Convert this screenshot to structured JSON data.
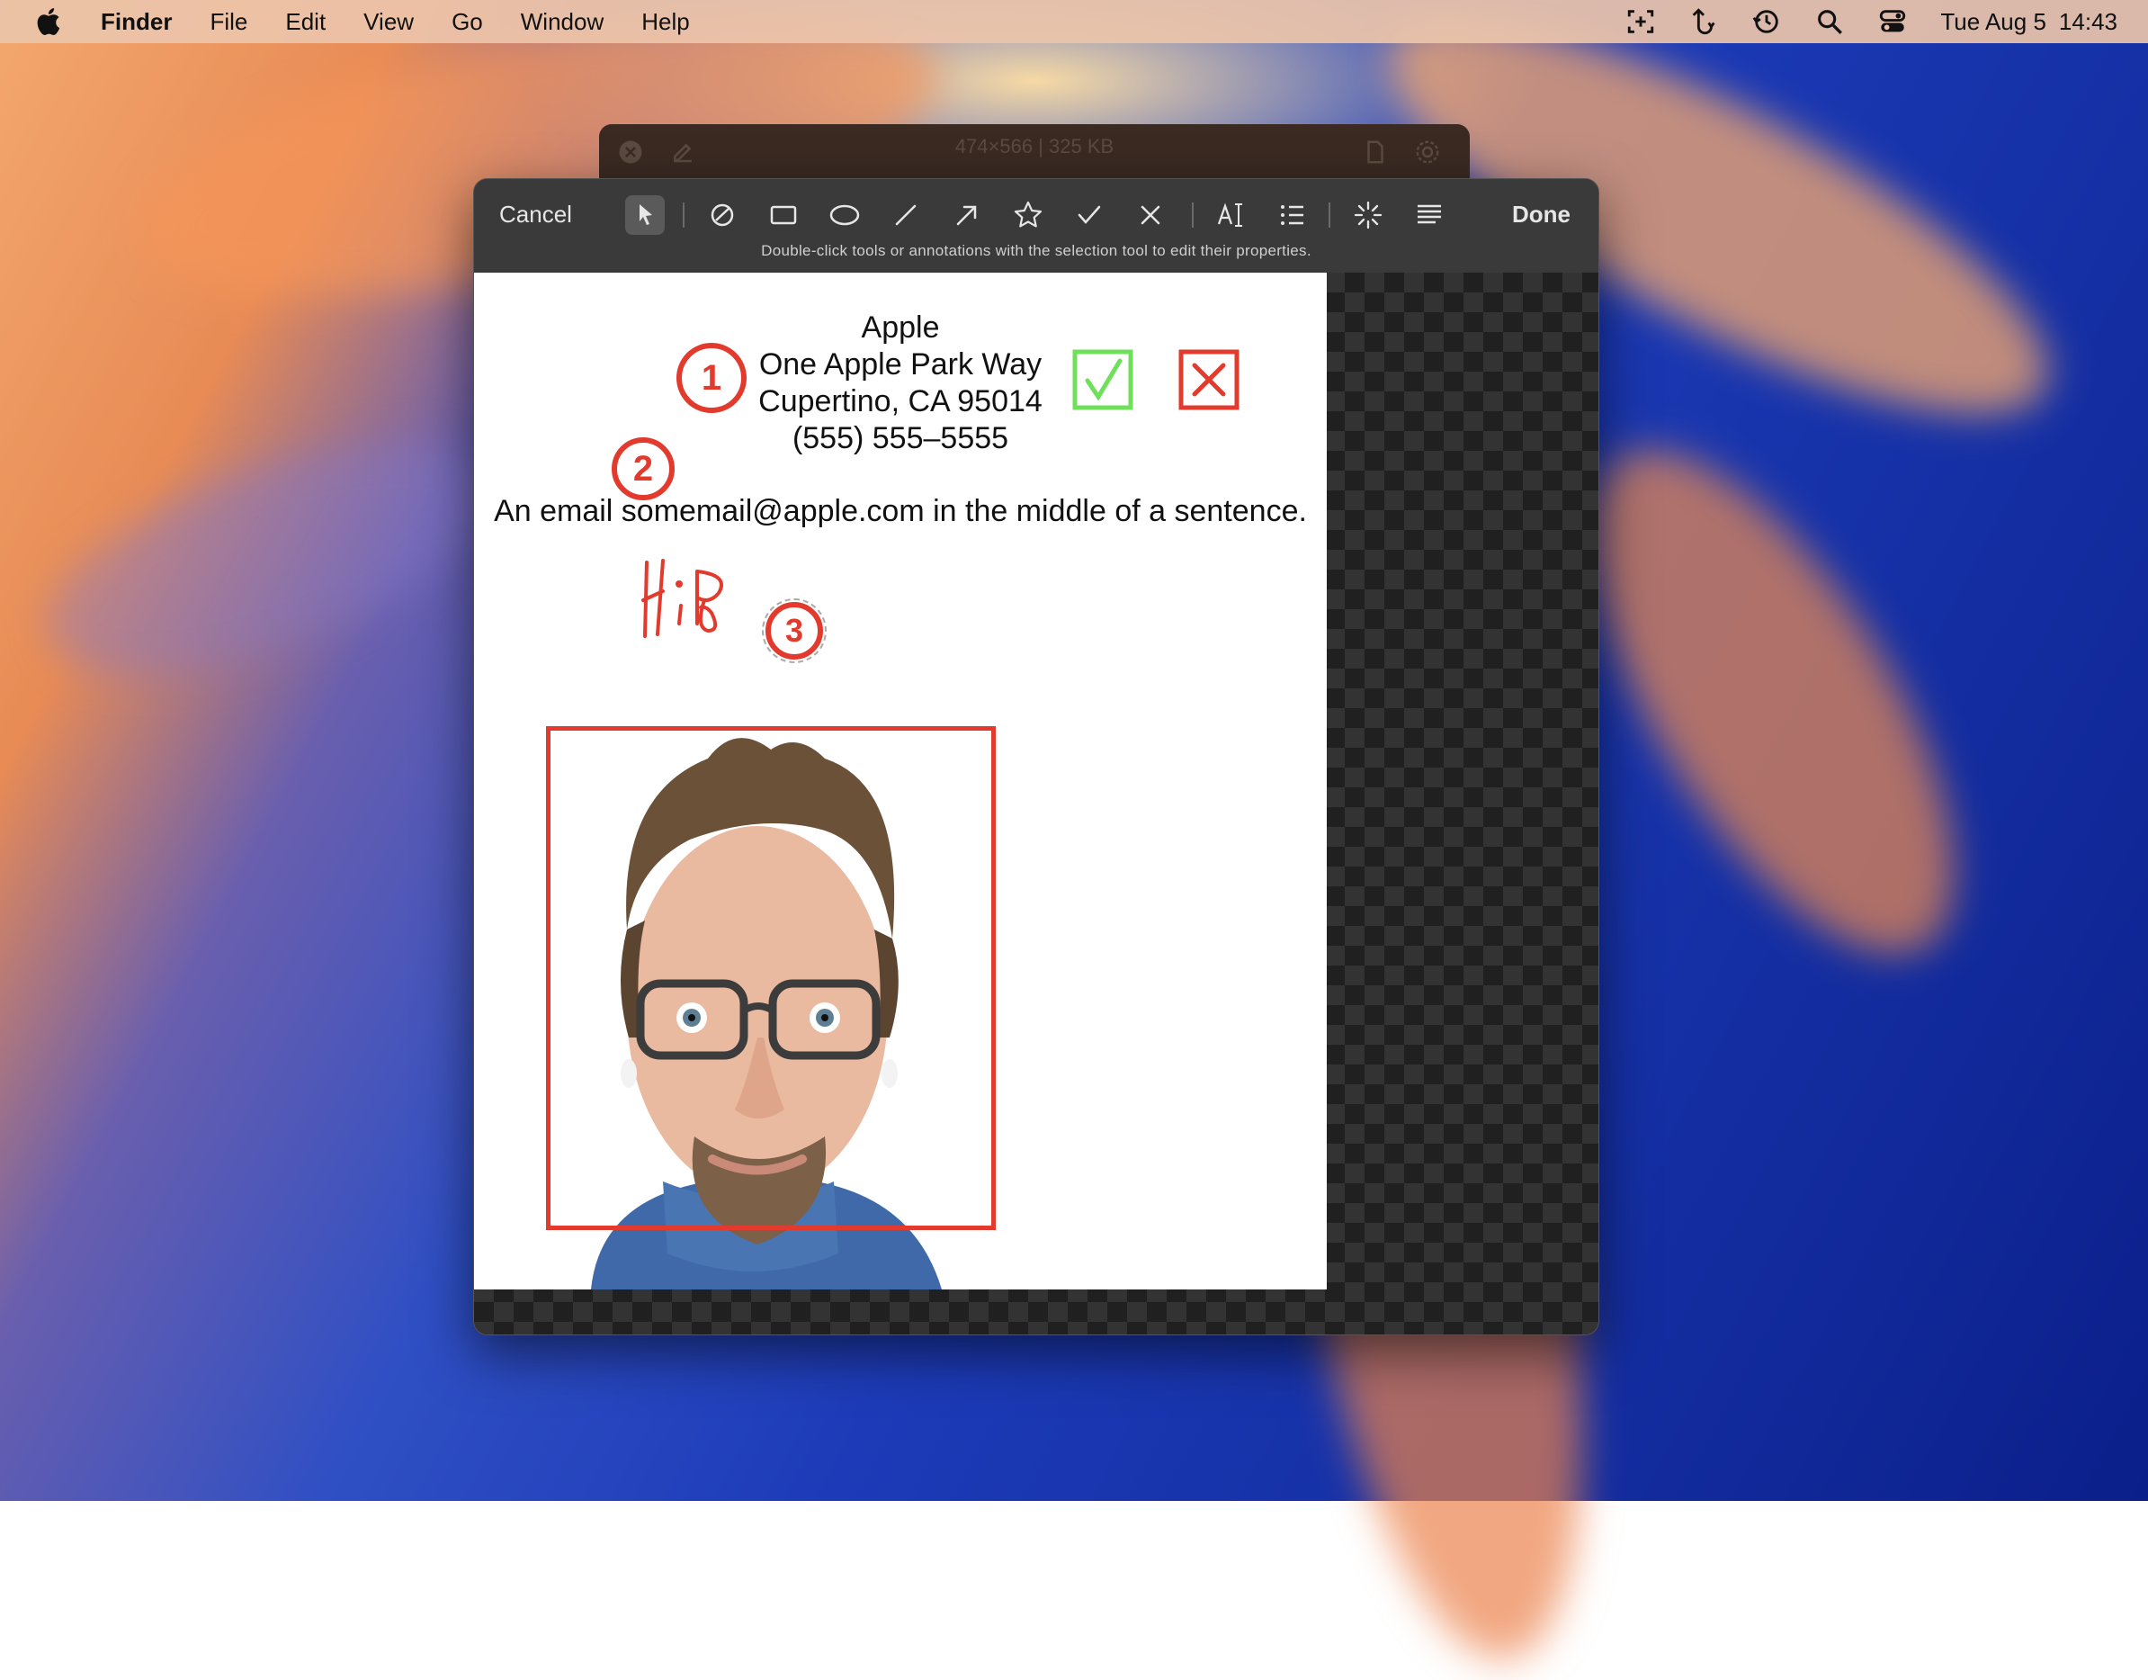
{
  "menubar": {
    "app_name": "Finder",
    "items": [
      "File",
      "Edit",
      "View",
      "Go",
      "Window",
      "Help"
    ],
    "status_icons": [
      "screenshot-icon",
      "sync-icon",
      "time-machine-icon",
      "search-icon",
      "control-center-icon"
    ],
    "date": "Tue Aug 5",
    "time": "14:43"
  },
  "background_window": {
    "title": "474×566 | 325 KB"
  },
  "markup": {
    "cancel_label": "Cancel",
    "done_label": "Done",
    "hint": "Double-click tools or annotations with the selection tool to edit their properties.",
    "tools": [
      "select-icon",
      "sketch-icon",
      "rectangle-icon",
      "oval-icon",
      "line-icon",
      "arrow-icon",
      "star-icon",
      "checkmark-icon",
      "cross-icon",
      "text-icon",
      "numbered-list-icon",
      "highlight-icon",
      "align-icon"
    ]
  },
  "document": {
    "address": {
      "line1": "Apple",
      "line2": "One Apple Park Way",
      "line3": "Cupertino, CA 95014",
      "line4": "(555) 555–5555"
    },
    "sentence": "An email somemail@apple.com in the middle of a sentence.",
    "badges": [
      "1",
      "2",
      "3"
    ]
  },
  "colors": {
    "annotation_red": "#e23b2e",
    "annotation_green": "#6fe05a",
    "toolbar_bg": "#3a3a3a"
  }
}
